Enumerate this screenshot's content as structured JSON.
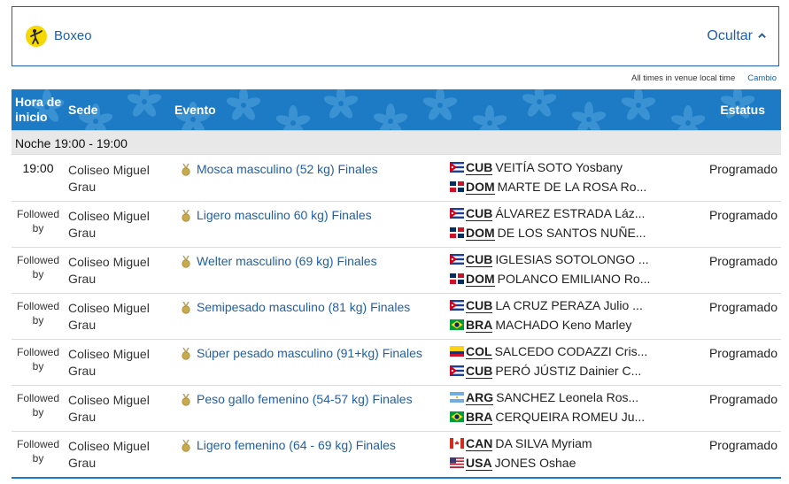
{
  "sport": {
    "name": "Boxeo",
    "toggle_label": "Ocultar",
    "icon": "boxing-pictogram-icon",
    "accent": "#1f5fa8",
    "icon_color": "#f5d800"
  },
  "timezone": {
    "note": "All times in venue local time",
    "change_label": "Cambio"
  },
  "table": {
    "headers": {
      "start": "Hora de inicio",
      "venue": "Sede",
      "event": "Evento",
      "status": "Estatus"
    },
    "header_color": "#1c7bc4",
    "group_label": "Noche  19:00 - 19:00",
    "rows": [
      {
        "time": "19:00",
        "followed": "",
        "venue": "Coliseo Miguel Grau",
        "event": "Mosca masculino (52 kg) Finales",
        "competitors": [
          {
            "code": "CUB",
            "name": "VEITÍA SOTO Yosbany",
            "flag": "cuba-flag-icon"
          },
          {
            "code": "DOM",
            "name": "MARTE DE LA ROSA Ro...",
            "flag": "dominican-republic-flag-icon"
          }
        ],
        "status": "Programado"
      },
      {
        "time": "",
        "followed": "Followed by",
        "venue": "Coliseo Miguel Grau",
        "event": "Ligero masculino 60 kg) Finales",
        "competitors": [
          {
            "code": "CUB",
            "name": "ÁLVAREZ ESTRADA Láz...",
            "flag": "cuba-flag-icon"
          },
          {
            "code": "DOM",
            "name": "DE LOS SANTOS NUÑE...",
            "flag": "dominican-republic-flag-icon"
          }
        ],
        "status": "Programado"
      },
      {
        "time": "",
        "followed": "Followed by",
        "venue": "Coliseo Miguel Grau",
        "event": "Welter masculino (69 kg) Finales",
        "competitors": [
          {
            "code": "CUB",
            "name": "IGLESIAS SOTOLONGO ...",
            "flag": "cuba-flag-icon"
          },
          {
            "code": "DOM",
            "name": "POLANCO EMILIANO Ro...",
            "flag": "dominican-republic-flag-icon"
          }
        ],
        "status": "Programado"
      },
      {
        "time": "",
        "followed": "Followed by",
        "venue": "Coliseo Miguel Grau",
        "event": "Semipesado masculino (81 kg) Finales",
        "competitors": [
          {
            "code": "CUB",
            "name": "LA CRUZ PERAZA Julio ...",
            "flag": "cuba-flag-icon"
          },
          {
            "code": "BRA",
            "name": "MACHADO Keno Marley",
            "flag": "brazil-flag-icon"
          }
        ],
        "status": "Programado"
      },
      {
        "time": "",
        "followed": "Followed by",
        "venue": "Coliseo Miguel Grau",
        "event": "Súper pesado masculino (91+kg) Finales",
        "competitors": [
          {
            "code": "COL",
            "name": "SALCEDO CODAZZI Cris...",
            "flag": "colombia-flag-icon"
          },
          {
            "code": "CUB",
            "name": "PERÓ JÚSTIZ Dainier C...",
            "flag": "cuba-flag-icon"
          }
        ],
        "status": "Programado"
      },
      {
        "time": "",
        "followed": "Followed by",
        "venue": "Coliseo Miguel Grau",
        "event": "Peso gallo femenino (54-57 kg) Finales",
        "competitors": [
          {
            "code": "ARG",
            "name": "SANCHEZ Leonela Ros...",
            "flag": "argentina-flag-icon"
          },
          {
            "code": "BRA",
            "name": "CERQUEIRA ROMEU Ju...",
            "flag": "brazil-flag-icon"
          }
        ],
        "status": "Programado"
      },
      {
        "time": "",
        "followed": "Followed by",
        "venue": "Coliseo Miguel Grau",
        "event": "Ligero femenino (64 - 69 kg) Finales",
        "competitors": [
          {
            "code": "CAN",
            "name": "DA SILVA Myriam",
            "flag": "canada-flag-icon"
          },
          {
            "code": "USA",
            "name": "JONES Oshae",
            "flag": "usa-flag-icon"
          }
        ],
        "status": "Programado"
      }
    ]
  }
}
